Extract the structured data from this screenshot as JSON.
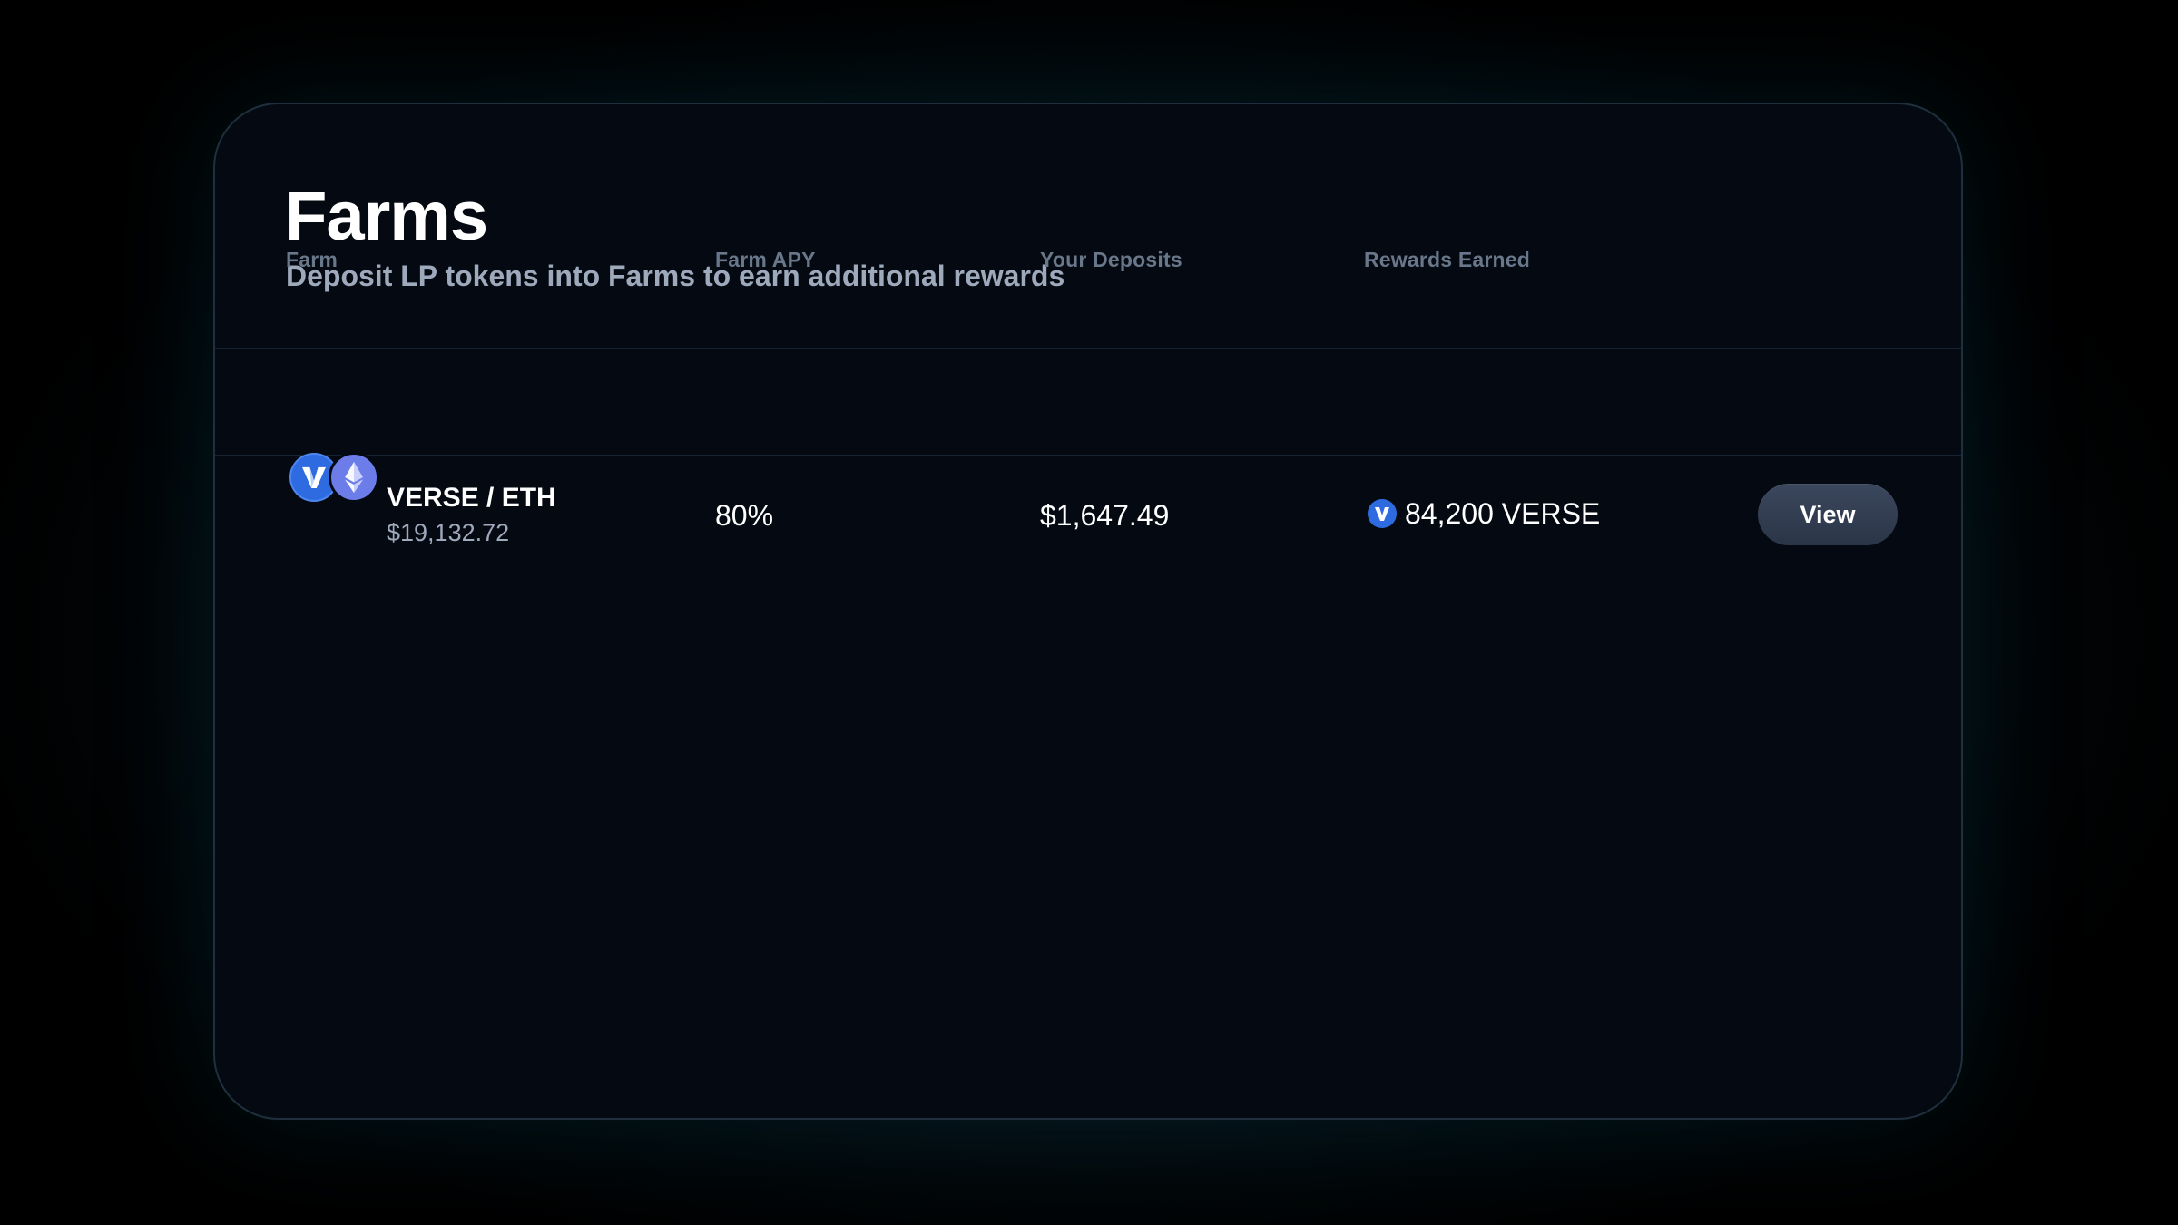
{
  "header": {
    "title": "Farms",
    "subtitle": "Deposit LP tokens into Farms to earn additional rewards"
  },
  "table": {
    "columns": [
      "Farm",
      "Farm APY",
      "Your Deposits",
      "Rewards Earned"
    ],
    "rows": [
      {
        "token_icons": [
          "verse-token-icon",
          "eth-token-icon"
        ],
        "pair": "VERSE / ETH",
        "tvl": "$19,132.72",
        "apy": "80%",
        "deposits": "$1,647.49",
        "reward_icon": "verse-token-icon",
        "rewards": "84,200 VERSE",
        "action_label": "View"
      }
    ]
  },
  "colors": {
    "verse_blue": "#2e6be0",
    "eth_purple": "#6c7dea",
    "card_bg": "#050a12",
    "muted_text": "#9ea9bb",
    "header_text": "#69778a",
    "button_bg": "#343f54"
  }
}
